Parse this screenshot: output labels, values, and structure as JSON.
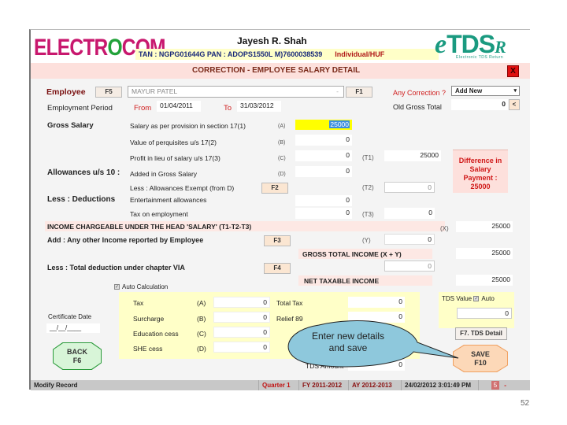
{
  "header": {
    "logo_left_part1": "ELECTR",
    "logo_left_o": "O",
    "logo_left_part2": "COM",
    "company_name": "Jayesh R. Shah",
    "tan_info": "TAN : NGPG01644G  PAN : ADOPS1550L  M)7600038539",
    "assessee_type": "Individual/HUF",
    "logo_right_e": "e",
    "logo_right_tds": "TDS",
    "logo_right_r": "R",
    "logo_right_sub": "Electronic TDS Return"
  },
  "titlebar": {
    "title": "CORRECTION - EMPLOYEE SALARY DETAIL",
    "close_label": "X"
  },
  "employee": {
    "label": "Employee",
    "f5": "F5",
    "name": "MAYUR PATEL",
    "f1": "F1",
    "any_correction_label": "Any Correction ?",
    "any_correction_value": "Add New",
    "old_gross_label": "Old Gross Total",
    "old_gross_value": "0",
    "old_gross_btn": "<"
  },
  "period": {
    "label": "Employment Period",
    "from_label": "From",
    "from_value": "01/04/2011",
    "to_label": "To",
    "to_value": "31/03/2012"
  },
  "gross": {
    "label": "Gross Salary",
    "rows": [
      {
        "desc": "Salary as per provision in section 17(1)",
        "tag": "(A)",
        "value": "25000"
      },
      {
        "desc": "Value of perquisites u/s 17(2)",
        "tag": "(B)",
        "value": "0"
      },
      {
        "desc": "Profit in lieu of salary u/s 17(3)",
        "tag": "(C)",
        "value": "0"
      }
    ],
    "t1_tag": "(T1)",
    "t1_value": "25000"
  },
  "allowances": {
    "label": "Allowances u/s 10 :",
    "added_desc": "Added in Gross Salary",
    "added_tag": "(D)",
    "added_value": "0",
    "exempt_desc": "Less : Allowances Exempt (from D)",
    "f2": "F2",
    "t2_tag": "(T2)",
    "t2_value": "0"
  },
  "deductions": {
    "label": "Less : Deductions",
    "entertainment_desc": "Entertainment allowances",
    "entertainment_value": "0",
    "tax_emp_desc": "Tax on employment",
    "tax_emp_value": "0",
    "t3_tag": "(T3)",
    "t3_value": "0"
  },
  "difference": {
    "text": "Difference in Salary Payment : 25000"
  },
  "income": {
    "chargeable_label": "INCOME CHARGEABLE UNDER THE HEAD 'SALARY'  (T1-T2-T3)",
    "x_tag": "(X)",
    "x_value": "25000",
    "other_label": "Add : Any other Income reported by Employee",
    "f3": "F3",
    "y_tag": "(Y)",
    "y_value": "0",
    "gti_label": "GROSS TOTAL INCOME (X + Y)",
    "gti_value": "25000",
    "via_label": "Less : Total deduction under chapter VIA",
    "f4": "F4",
    "via_value": "0",
    "nti_label": "NET TAXABLE INCOME",
    "nti_value": "25000"
  },
  "auto_calc": {
    "label": "Auto Calculation",
    "checked": true
  },
  "tax": {
    "rows": [
      {
        "desc": "Tax",
        "tag": "(A)",
        "value": "0"
      },
      {
        "desc": "Surcharge",
        "tag": "(B)",
        "value": "0"
      },
      {
        "desc": "Education cess",
        "tag": "(C)",
        "value": "0"
      },
      {
        "desc": "SHE cess",
        "tag": "(D)",
        "value": "0"
      }
    ],
    "total_tax_label": "Total Tax",
    "total_tax_value": "0",
    "relief_label": "Relief 89",
    "relief_value": "0",
    "tds_amount_label": "TDS Amount",
    "tds_amount_value": "0"
  },
  "tds_value": {
    "label": "TDS Value",
    "auto_label": "Auto",
    "auto_checked": true,
    "value": "0",
    "detail_btn": "F7. TDS Detail"
  },
  "certificate": {
    "label": "Certificate Date",
    "value": "__/__/____"
  },
  "buttons": {
    "back": "BACK",
    "back_key": "F6",
    "save": "SAVE",
    "save_key": "F10"
  },
  "callout": {
    "text_line1": "Enter new details",
    "text_line2": "and save"
  },
  "status_bar": {
    "mode": "Modify Record",
    "quarter": "Quarter 1",
    "fy": "FY 2011-2012",
    "ay": "AY 2012-2013",
    "datetime": "24/02/2012 3:01:49 PM",
    "count": "5",
    "minimize": "-"
  },
  "slide": {
    "page_number": "52"
  }
}
